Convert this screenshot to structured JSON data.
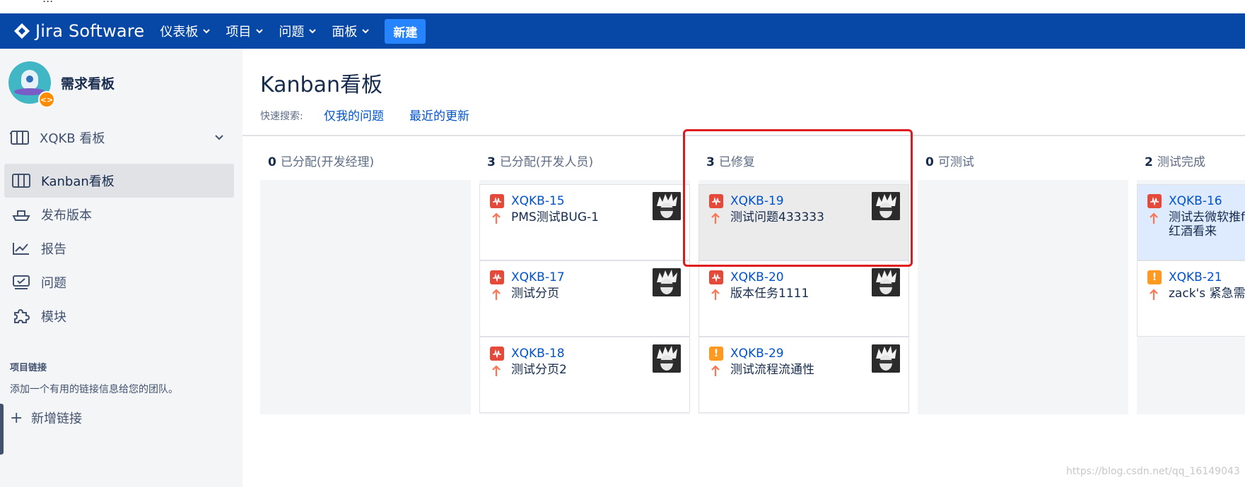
{
  "banner": {
    "text": "..."
  },
  "nav": {
    "logo": "Jira Software",
    "items": [
      "仪表板",
      "项目",
      "问题",
      "面板"
    ],
    "create": "新建"
  },
  "sidebar": {
    "project_name": "需求看板",
    "board_selector": "XQKB 看板",
    "items": [
      "Kanban看板",
      "发布版本",
      "报告",
      "问题",
      "模块"
    ],
    "links_heading": "项目链接",
    "links_desc": "添加一个有用的链接信息给您的团队。",
    "add_link": "新增链接"
  },
  "main": {
    "title": "Kanban看板",
    "quick_search_label": "快速搜索:",
    "quick_filters": [
      "仅我的问题",
      "最近的更新"
    ]
  },
  "columns": [
    {
      "count": "0",
      "name": "已分配(开发经理)",
      "cards": []
    },
    {
      "count": "3",
      "name": "已分配(开发人员)",
      "cards": [
        {
          "key": "XQKB-15",
          "summary": "PMS测试BUG-1",
          "type": "bug"
        },
        {
          "key": "XQKB-17",
          "summary": "测试分页",
          "type": "bug"
        },
        {
          "key": "XQKB-18",
          "summary": "测试分页2",
          "type": "bug"
        }
      ]
    },
    {
      "count": "3",
      "name": "已修复",
      "cards": [
        {
          "key": "XQKB-19",
          "summary": "测试问题433333",
          "type": "bug"
        },
        {
          "key": "XQKB-20",
          "summary": "版本任务1111",
          "type": "bug"
        },
        {
          "key": "XQKB-29",
          "summary": "测试流程流通性",
          "type": "urgent"
        }
      ]
    },
    {
      "count": "0",
      "name": "可测试",
      "cards": []
    },
    {
      "count": "2",
      "name": "测试完成",
      "cards": [
        {
          "key": "XQKB-16",
          "summary": "测试去微软推f",
          "summary2": "红酒看来",
          "type": "bug"
        },
        {
          "key": "XQKB-21",
          "summary": "zack's 紧急需求",
          "type": "urgent"
        }
      ]
    }
  ],
  "watermark": "https://blog.csdn.net/qq_16149043",
  "colors": {
    "nav": "#0747a6",
    "create": "#2684ff",
    "bug": "#e5493a",
    "urgent": "#ff991f",
    "priority": "#ff7452",
    "highlight_box": "#e0191f"
  },
  "icons": [
    "jira-logo-icon",
    "chevron-down-icon",
    "board-icon",
    "ship-icon",
    "chart-icon",
    "issues-icon",
    "puzzle-icon",
    "plus-icon",
    "bug-icon",
    "urgent-icon",
    "priority-high-icon"
  ]
}
